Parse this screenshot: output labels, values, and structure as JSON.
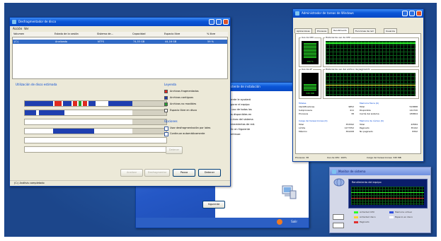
{
  "colors": {
    "desktop": "#1f4e94",
    "frag_red": "#e02a1f",
    "contig_blue": "#1f3fb0",
    "system_green": "#25a030",
    "free_white": "#ffffff"
  },
  "defrag": {
    "title": "Desfragmentador de disco",
    "menu": [
      "Acción",
      "Ver"
    ],
    "columns": [
      "Volumen",
      "Estado de la sesión",
      "Sistema de...",
      "Capacidad",
      "Espacio libre",
      "% libre"
    ],
    "row": [
      "(C:)",
      "Analizado",
      "NTFS",
      "74,53 GB",
      "44,16 GB",
      "59 %"
    ],
    "usage_title": "Utilización de disco estimada",
    "legend_title": "Leyenda",
    "legend": [
      "Archivos fragmentados",
      "Archivos contiguos",
      "Archivos no movibles",
      "Espacio libre en disco"
    ],
    "options_title": "Opciones",
    "options": [
      "Usar desfragmentación por lotes",
      "Continuar automáticamente"
    ],
    "defrag_label": "Detener",
    "buttons": [
      "Analizar",
      "Desfragmentar",
      "Pausa",
      "Detener"
    ],
    "status": "(C:) Análisis completado"
  },
  "wizard": {
    "heading": "Asistente de instalación",
    "lines": [
      "El asistente le ayudará",
      "a configurar el equipo",
      "para el uso de todos los",
      "recursos disponibles en",
      "el disco duro del sistema",
      "y las herramientas de red.",
      "Haga clic en Siguiente",
      "para continuar."
    ],
    "next_label": "Siguiente",
    "bottom_label": "Salir"
  },
  "taskmgr": {
    "title": "Administrador de tareas de Windows",
    "tabs": [
      "Aplicaciones",
      "Procesos",
      "Rendimiento",
      "Funciones de red",
      "Usuarios"
    ],
    "active_tab": 2,
    "cpu_box": "Uso de CPU",
    "cpu_hist": "Historial de uso de CPU",
    "cpu_value": "100 %",
    "pf_box": "Uso de AF",
    "pf_hist": "Historial de uso del archivo de paginación",
    "pf_value": "345 MB",
    "totals": [
      [
        "Totales",
        ""
      ],
      [
        "Identificadores",
        "9852"
      ],
      [
        "Subprocesos",
        "411"
      ],
      [
        "Procesos",
        "38"
      ]
    ],
    "physmem": [
      [
        "Memoria física (K)",
        ""
      ],
      [
        "Total",
        "523888"
      ],
      [
        "Disponible",
        "141720"
      ],
      [
        "Caché del sistema",
        "183804"
      ]
    ],
    "commit": [
      [
        "Carga de transacciones (K)",
        ""
      ],
      [
        "Total",
        "353392"
      ],
      [
        "Límite",
        "1277352"
      ],
      [
        "Máximo",
        "361208"
      ]
    ],
    "kernel": [
      [
        "Memoria de núcleo (K)",
        ""
      ],
      [
        "Total",
        "43584"
      ],
      [
        "Paginado",
        "35192"
      ],
      [
        "No paginado",
        "8392"
      ]
    ],
    "status": [
      "Procesos: 38",
      "Uso de CPU: 100%",
      "Carga de transacciones: 345 MB"
    ]
  },
  "cluster": {
    "title": "Monitor de sistema",
    "graph_title": "Rendimiento del equipo",
    "legend": [
      "Actividad CPU",
      "Memoria virtual",
      "Actividad disco",
      "Espacio en disco",
      "Paginado"
    ]
  }
}
